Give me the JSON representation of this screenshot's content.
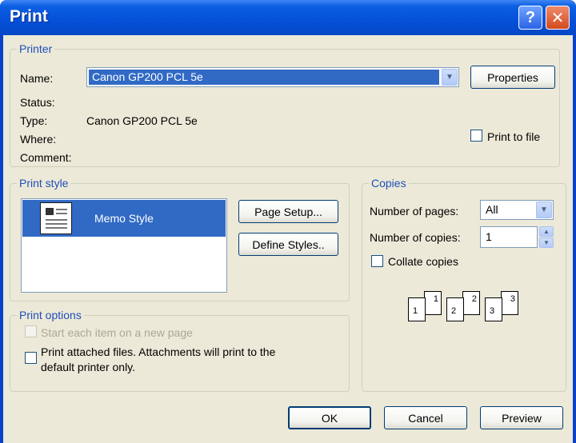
{
  "window": {
    "title": "Print"
  },
  "printer": {
    "group_label": "Printer",
    "name_label": "Name:",
    "name_value": "Canon GP200 PCL 5e",
    "properties_label": "Properties",
    "status_label": "Status:",
    "type_label": "Type:",
    "type_value": "Canon GP200 PCL 5e",
    "where_label": "Where:",
    "comment_label": "Comment:",
    "print_to_file_label": "Print to file"
  },
  "print_style": {
    "group_label": "Print style",
    "selected_item": "Memo Style",
    "page_setup_label": "Page Setup...",
    "define_styles_label": "Define Styles.."
  },
  "copies": {
    "group_label": "Copies",
    "number_of_pages_label": "Number of pages:",
    "number_of_pages_value": "All",
    "number_of_copies_label": "Number of copies:",
    "number_of_copies_value": "1",
    "collate_label": "Collate copies",
    "collate_pages": [
      "1",
      "1",
      "2",
      "2",
      "3",
      "3"
    ]
  },
  "print_options": {
    "group_label": "Print options",
    "start_each_item_label": "Start each item on a new page",
    "print_attached_label_line1": "Print attached files.  Attachments will print to the",
    "print_attached_label_line2": "default printer only."
  },
  "footer": {
    "ok_label": "OK",
    "cancel_label": "Cancel",
    "preview_label": "Preview"
  },
  "colors": {
    "titlebar": "#0450d8",
    "dialog_bg": "#ece9d8",
    "group_label": "#1f4fb8",
    "selection": "#316ac5"
  }
}
